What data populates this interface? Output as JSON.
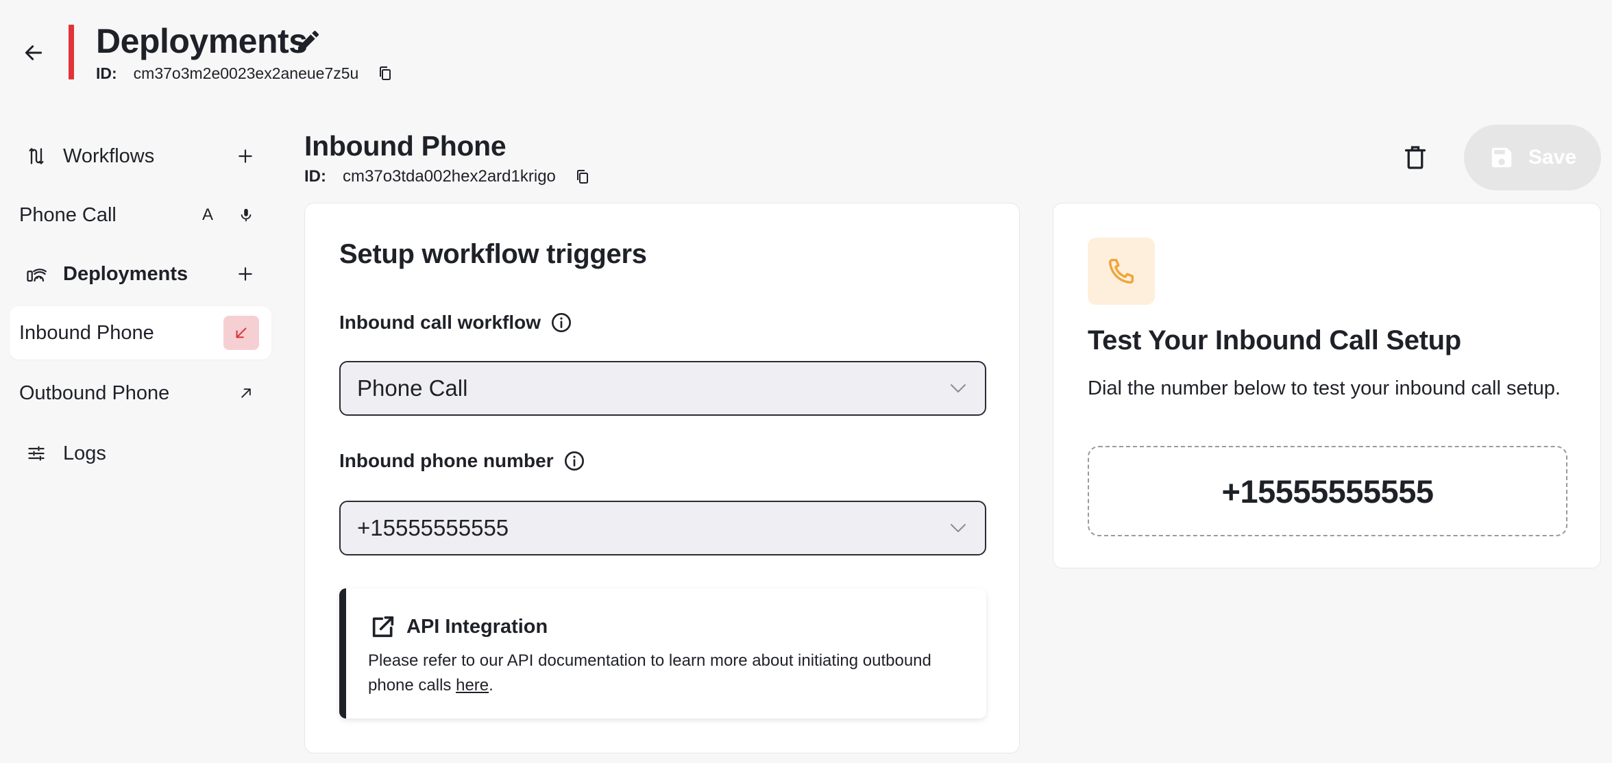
{
  "header": {
    "title": "Deployments",
    "id_label": "ID:",
    "id_value": "cm37o3m2e0023ex2aneue7z5u"
  },
  "sidebar": {
    "items": [
      {
        "label": "Workflows",
        "icon": "workflow-icon"
      },
      {
        "label": "Phone Call",
        "badge": "A",
        "icon": "microphone-icon"
      },
      {
        "label": "Deployments",
        "icon": "deployments-icon"
      },
      {
        "label": "Inbound Phone",
        "icon": "arrow-down-left-icon",
        "active": true
      },
      {
        "label": "Outbound Phone",
        "icon": "arrow-up-right-icon"
      },
      {
        "label": "Logs",
        "icon": "sliders-icon"
      }
    ]
  },
  "main": {
    "title": "Inbound Phone",
    "id_label": "ID:",
    "id_value": "cm37o3tda002hex2ard1krigo",
    "save_label": "Save"
  },
  "triggers": {
    "heading": "Setup workflow triggers",
    "workflow_label": "Inbound call workflow",
    "workflow_value": "Phone Call",
    "phone_label": "Inbound phone number",
    "phone_value": "+15555555555"
  },
  "api": {
    "title": "API Integration",
    "text": "Please refer to our API documentation to learn more about initiating outbound phone calls ",
    "link": "here",
    "suffix": "."
  },
  "test": {
    "title": "Test Your Inbound Call Setup",
    "description": "Dial the number below to test your inbound call setup.",
    "number": "+15555555555"
  },
  "colors": {
    "accent_red": "#e2323a",
    "inbound_badge_bg": "#f6cfd3",
    "phone_tile_bg": "#fdefdc",
    "phone_icon": "#f0a43a"
  }
}
